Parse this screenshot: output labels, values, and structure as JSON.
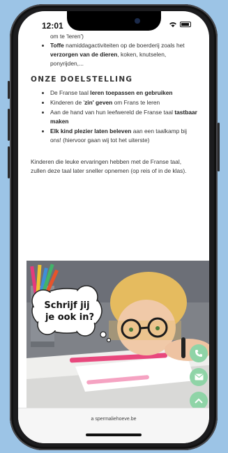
{
  "status_bar": {
    "time": "12:01"
  },
  "top_list": {
    "continuation": "om te 'leren')",
    "item": {
      "bold1": "Toffe",
      "text1": " namiddagactiviteiten op de boerderij zoals het ",
      "bold2": "verzorgen van de dieren",
      "text2": ", koken, knutselen, ponyrijden,..."
    }
  },
  "goals": {
    "title": "ONZE DOELSTELLING",
    "items": [
      {
        "pre": "De Franse taal ",
        "bold": "leren toepassen en gebruiken",
        "post": ""
      },
      {
        "pre": "Kinderen de '",
        "bold": "zin' geven",
        "post": " om Frans te leren"
      },
      {
        "pre": "Aan de hand van hun leefwereld de Franse taal ",
        "bold": "tastbaar maken",
        "post": ""
      },
      {
        "pre": "",
        "bold": "Elk kind plezier laten beleven",
        "post": " aan een taalkamp bij ons! (hiervoor gaan wij tot het uiterste)"
      }
    ]
  },
  "paragraph": "Kinderen die leuke ervaringen hebben met de Franse taal, zullen deze taal later sneller opnemen (op reis of in de klas).",
  "photo": {
    "bubble_line1": "Schrijf jij",
    "bubble_line2": "je ook in?"
  },
  "fabs": {
    "phone": "phone-icon",
    "mail": "mail-icon",
    "up": "chevron-up-icon"
  },
  "browser": {
    "url": "spermaliehoeve.be"
  },
  "colors": {
    "fab": "#8fd4a7",
    "background": "#9cc4e6"
  }
}
